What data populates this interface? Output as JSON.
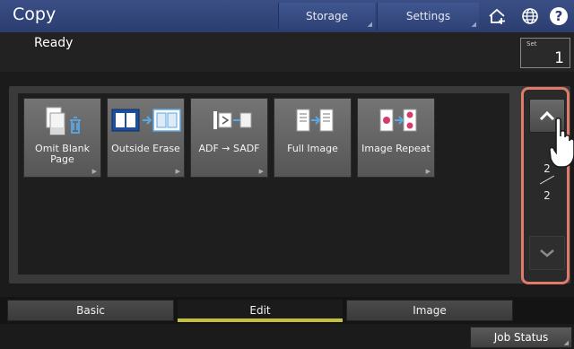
{
  "app": {
    "title": "Copy"
  },
  "header": {
    "storage_label": "Storage",
    "settings_label": "Settings",
    "icons": [
      "home-add-icon",
      "globe-icon",
      "help-icon"
    ],
    "help_glyph": "?"
  },
  "status": {
    "text": "Ready"
  },
  "copies": {
    "label": "Set",
    "value": "1"
  },
  "functions": [
    {
      "label": "Omit Blank Page",
      "icon": "omit-blank-page-icon"
    },
    {
      "label": "Outside Erase",
      "icon": "outside-erase-icon"
    },
    {
      "label": "ADF → SADF",
      "icon": "adf-sadf-icon"
    },
    {
      "label": "Full Image",
      "icon": "full-image-icon"
    },
    {
      "label": "Image Repeat",
      "icon": "image-repeat-icon"
    }
  ],
  "pagination": {
    "current": "2",
    "total": "2"
  },
  "tabs": [
    {
      "label": "Basic",
      "active": false
    },
    {
      "label": "Edit",
      "active": true
    },
    {
      "label": "Image",
      "active": false
    }
  ],
  "footer": {
    "job_status_label": "Job Status"
  },
  "colors": {
    "accent_header": "#2f4277",
    "highlight_ring": "#e07a6c",
    "active_tab_underline": "#c7c03a"
  }
}
